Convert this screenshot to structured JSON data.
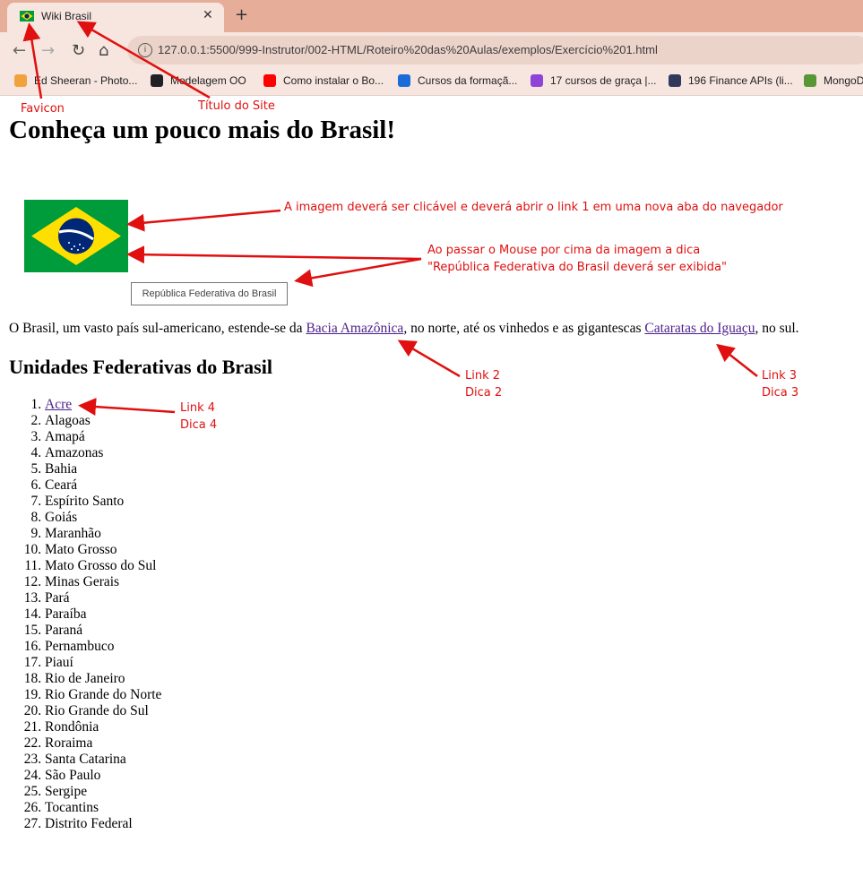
{
  "browser": {
    "tab_title": "Wiki Brasil",
    "tab_close": "✕",
    "new_tab": "+",
    "url": "127.0.0.1:5500/999-Instrutor/002-HTML/Roteiro%20das%20Aulas/exemplos/Exercício%201.html",
    "bookmarks": [
      {
        "label": "Ed Sheeran - Photo...",
        "icon": "mushroom-icon",
        "color": "#f2a23c"
      },
      {
        "label": "Modelagem OO",
        "icon": "github-icon",
        "color": "#202124"
      },
      {
        "label": "Como instalar o Bo...",
        "icon": "youtube-icon",
        "color": "#ff0000"
      },
      {
        "label": "Cursos da formaçã...",
        "icon": "alura-icon",
        "color": "#1b6cd9"
      },
      {
        "label": "17 cursos de graça |...",
        "icon": "hexagon-icon",
        "color": "#8e44d8"
      },
      {
        "label": "196 Finance APIs (li...",
        "icon": "rapidapi-icon",
        "color": "#2f3a5a"
      },
      {
        "label": "MongoD",
        "icon": "mongodb-icon",
        "color": "#589636"
      }
    ]
  },
  "annotations": {
    "favicon": "Favicon",
    "site_title": "Título do Site",
    "image_click_line1": "A imagem deverá ser clicável e deverá abrir o link 1 em uma nova aba do navegador",
    "hover_line1": "Ao passar o Mouse por cima da imagem a dica",
    "hover_line2": "\"República Federativa do Brasil deverá ser exibida\"",
    "link2": "Link 2",
    "dica2": "Dica 2",
    "link3": "Link 3",
    "dica3": "Dica 3",
    "link4": "Link 4",
    "dica4": "Dica 4"
  },
  "page": {
    "heading": "Conheça um pouco mais do Brasil!",
    "tooltip": "República Federativa do Brasil",
    "paragraph": {
      "before": "O Brasil, um vasto país sul-americano, estende-se da ",
      "link1": "Bacia Amazônica",
      "middle": ", no norte, até os vinhedos e as gigantescas ",
      "link2": "Cataratas do Iguaçu",
      "after": ", no sul."
    },
    "subheading": "Unidades Federativas do Brasil",
    "states": [
      "Acre",
      "Alagoas",
      "Amapá",
      "Amazonas",
      "Bahia",
      "Ceará",
      "Espírito Santo",
      "Goiás",
      "Maranhão",
      "Mato Grosso",
      "Mato Grosso do Sul",
      "Minas Gerais",
      "Pará",
      "Paraíba",
      "Paraná",
      "Pernambuco",
      "Piauí",
      "Rio de Janeiro",
      "Rio Grande do Norte",
      "Rio Grande do Sul",
      "Rondônia",
      "Roraima",
      "Santa Catarina",
      "São Paulo",
      "Sergipe",
      "Tocantins",
      "Distrito Federal"
    ]
  },
  "colors": {
    "tabbar": "#e6ad99",
    "annotation": "#e01010",
    "link": "#4b1f8a"
  }
}
